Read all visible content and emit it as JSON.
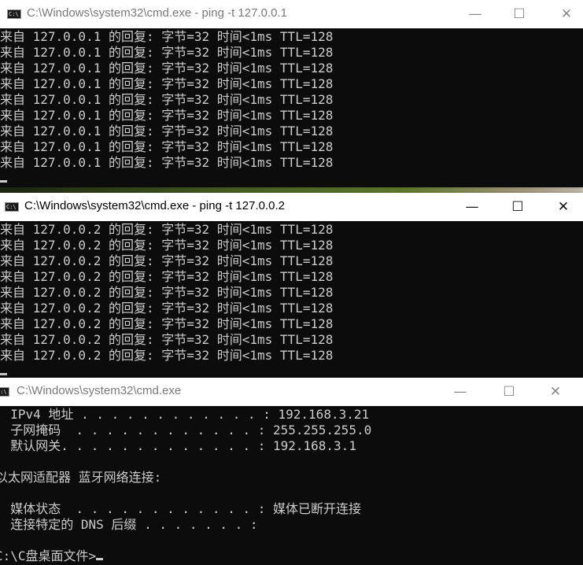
{
  "window1": {
    "title": "C:\\Windows\\system32\\cmd.exe - ping  -t 127.0.0.1",
    "icon_text": "C:\\",
    "lines": [
      "来自 127.0.0.1 的回复: 字节=32 时间<1ms TTL=128",
      "来自 127.0.0.1 的回复: 字节=32 时间<1ms TTL=128",
      "来自 127.0.0.1 的回复: 字节=32 时间<1ms TTL=128",
      "来自 127.0.0.1 的回复: 字节=32 时间<1ms TTL=128",
      "来自 127.0.0.1 的回复: 字节=32 时间<1ms TTL=128",
      "来自 127.0.0.1 的回复: 字节=32 时间<1ms TTL=128",
      "来自 127.0.0.1 的回复: 字节=32 时间<1ms TTL=128",
      "来自 127.0.0.1 的回复: 字节=32 时间<1ms TTL=128",
      "来自 127.0.0.1 的回复: 字节=32 时间<1ms TTL=128"
    ]
  },
  "window2": {
    "title": "C:\\Windows\\system32\\cmd.exe - ping  -t 127.0.0.2",
    "icon_text": "C:\\",
    "lines": [
      "来自 127.0.0.2 的回复: 字节=32 时间<1ms TTL=128",
      "来自 127.0.0.2 的回复: 字节=32 时间<1ms TTL=128",
      "来自 127.0.0.2 的回复: 字节=32 时间<1ms TTL=128",
      "来自 127.0.0.2 的回复: 字节=32 时间<1ms TTL=128",
      "来自 127.0.0.2 的回复: 字节=32 时间<1ms TTL=128",
      "来自 127.0.0.2 的回复: 字节=32 时间<1ms TTL=128",
      "来自 127.0.0.2 的回复: 字节=32 时间<1ms TTL=128",
      "来自 127.0.0.2 的回复: 字节=32 时间<1ms TTL=128",
      "来自 127.0.0.2 的回复: 字节=32 时间<1ms TTL=128"
    ]
  },
  "window3": {
    "title": "C:\\Windows\\system32\\cmd.exe",
    "icon_text": "C:\\",
    "lines": [
      "  IPv4 地址 . . . . . . . . . . . . : 192.168.3.21",
      "  子网掩码  . . . . . . . . . . . . : 255.255.255.0",
      "  默认网关. . . . . . . . . . . . . : 192.168.3.1",
      "",
      "以太网适配器 蓝牙网络连接:",
      "",
      "  媒体状态  . . . . . . . . . . . . : 媒体已断开连接",
      "  连接特定的 DNS 后缀 . . . . . . . :",
      ""
    ],
    "prompt": "C:\\C盘桌面文件>"
  },
  "controls": {
    "minimize": "—",
    "maximize": "☐",
    "close": "✕"
  },
  "colors": {
    "console_bg": "#0c0c0c",
    "console_text": "#cccccc",
    "titlebar_bg": "#ffffff",
    "inactive_title": "#7a7a7a"
  }
}
